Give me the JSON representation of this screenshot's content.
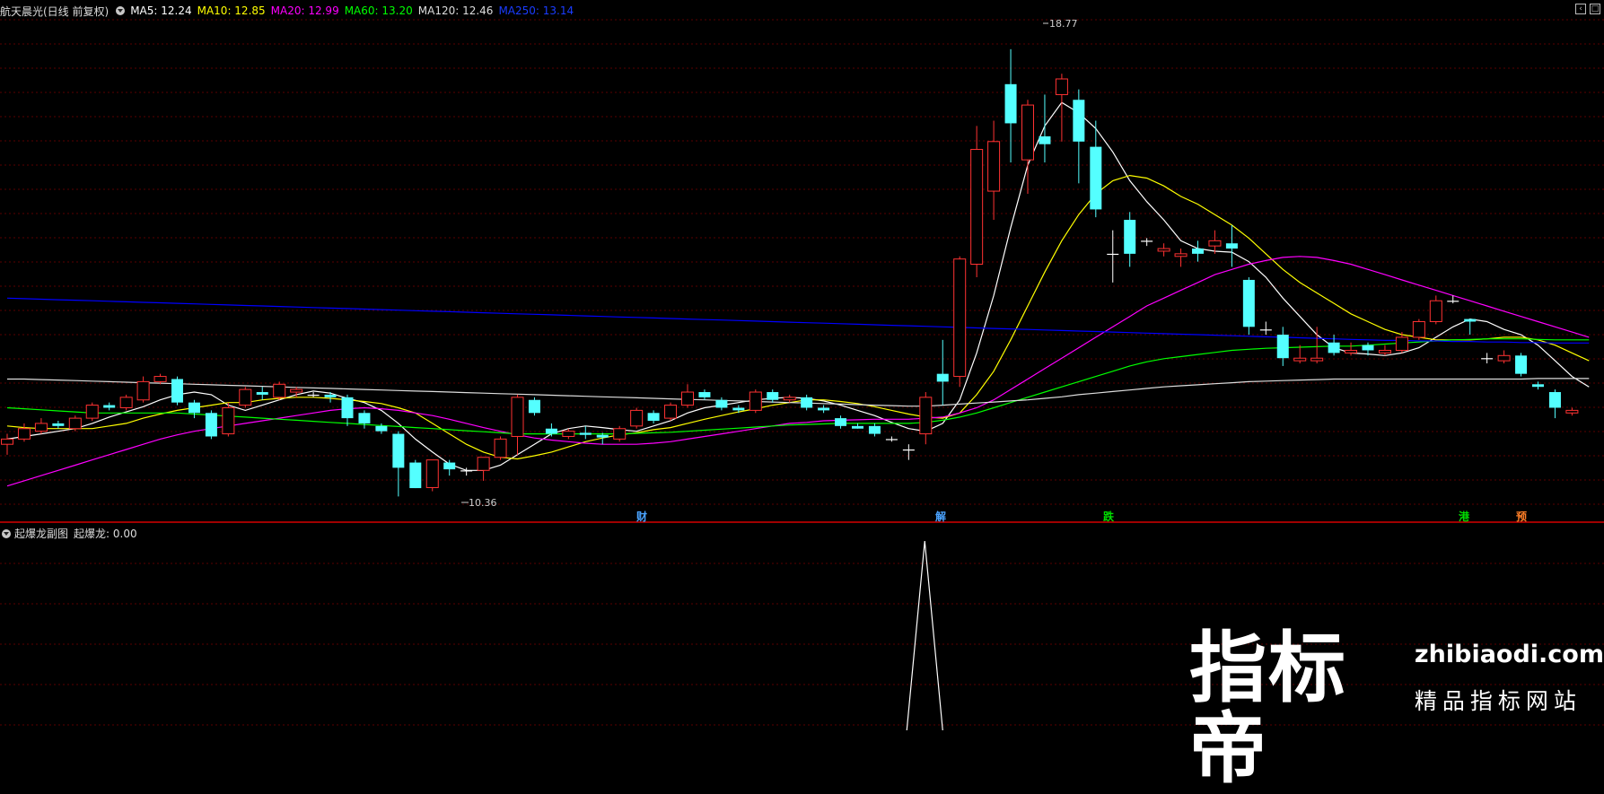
{
  "header": {
    "title": "航天晨光(日线 前复权)",
    "ma": [
      {
        "label": "MA5: 12.24",
        "color": "#ffffff"
      },
      {
        "label": "MA10: 12.85",
        "color": "#ffff00"
      },
      {
        "label": "MA20: 12.99",
        "color": "#ff00ff"
      },
      {
        "label": "MA60: 13.20",
        "color": "#00ff00"
      },
      {
        "label": "MA120: 12.46",
        "color": "#dddddd"
      },
      {
        "label": "MA250: 13.14",
        "color": "#0000ff"
      }
    ]
  },
  "annotations": {
    "high": "18.77",
    "low": "10.36"
  },
  "events": [
    {
      "label": "财",
      "color": "#4aa3ff"
    },
    {
      "label": "解",
      "color": "#4aa3ff"
    },
    {
      "label": "跌",
      "color": "#00dd00"
    },
    {
      "label": "港",
      "color": "#00dd00"
    },
    {
      "label": "预",
      "color": "#ff7f27"
    }
  ],
  "sub_header": {
    "name": "起爆龙副图",
    "indicator": "起爆龙: 0.00"
  },
  "watermark": {
    "big": "指标帝",
    "url": "zhibiaodi.com",
    "slogan": "精品指标网站"
  },
  "colors": {
    "up": "#ff3232",
    "down": "#54ffff",
    "grid": "#5a0000",
    "divider": "#a00000"
  },
  "chart_data": {
    "type": "candlestick",
    "price_range": [
      10.0,
      19.3
    ],
    "candles": [
      [
        11.2,
        11.3,
        11.0,
        11.4
      ],
      [
        11.3,
        11.5,
        11.25,
        11.6
      ],
      [
        11.45,
        11.6,
        11.4,
        11.7
      ],
      [
        11.6,
        11.55,
        11.5,
        11.65
      ],
      [
        11.5,
        11.7,
        11.45,
        11.75
      ],
      [
        11.7,
        11.95,
        11.65,
        12.0
      ],
      [
        11.95,
        11.9,
        11.85,
        12.0
      ],
      [
        11.9,
        12.1,
        11.85,
        12.15
      ],
      [
        12.05,
        12.4,
        12.0,
        12.5
      ],
      [
        12.4,
        12.5,
        12.35,
        12.55
      ],
      [
        12.45,
        12.0,
        11.95,
        12.5
      ],
      [
        12.0,
        11.8,
        11.7,
        12.05
      ],
      [
        11.8,
        11.35,
        11.3,
        11.85
      ],
      [
        11.4,
        11.9,
        11.35,
        12.0
      ],
      [
        11.95,
        12.25,
        11.9,
        12.3
      ],
      [
        12.2,
        12.15,
        12.05,
        12.3
      ],
      [
        12.1,
        12.35,
        12.05,
        12.4
      ],
      [
        12.2,
        12.25,
        12.1,
        12.3
      ],
      [
        12.15,
        12.15,
        12.1,
        12.2
      ],
      [
        12.15,
        12.1,
        12.0,
        12.2
      ],
      [
        12.1,
        11.7,
        11.55,
        12.15
      ],
      [
        11.8,
        11.6,
        11.5,
        11.85
      ],
      [
        11.55,
        11.45,
        11.4,
        11.6
      ],
      [
        11.4,
        10.75,
        10.2,
        11.45
      ],
      [
        10.85,
        10.36,
        10.36,
        10.9
      ],
      [
        10.37,
        10.9,
        10.3,
        10.9
      ],
      [
        10.85,
        10.72,
        10.6,
        10.9
      ],
      [
        10.7,
        10.7,
        10.6,
        10.75
      ],
      [
        10.7,
        10.95,
        10.5,
        10.95
      ],
      [
        10.95,
        11.3,
        10.9,
        11.35
      ],
      [
        11.35,
        12.1,
        11.0,
        12.15
      ],
      [
        12.05,
        11.8,
        11.75,
        12.1
      ],
      [
        11.5,
        11.4,
        11.35,
        11.6
      ],
      [
        11.35,
        11.45,
        11.3,
        11.5
      ],
      [
        11.42,
        11.38,
        11.3,
        11.55
      ],
      [
        11.38,
        11.33,
        11.2,
        11.42
      ],
      [
        11.3,
        11.5,
        11.25,
        11.55
      ],
      [
        11.55,
        11.85,
        11.5,
        11.9
      ],
      [
        11.8,
        11.65,
        11.6,
        11.85
      ],
      [
        11.7,
        11.95,
        11.65,
        12.0
      ],
      [
        11.95,
        12.2,
        11.9,
        12.35
      ],
      [
        12.2,
        12.1,
        12.05,
        12.25
      ],
      [
        12.05,
        11.9,
        11.85,
        12.1
      ],
      [
        11.9,
        11.85,
        11.8,
        11.95
      ],
      [
        11.85,
        12.2,
        11.8,
        12.25
      ],
      [
        12.2,
        12.05,
        12.0,
        12.25
      ],
      [
        12.05,
        12.1,
        12.0,
        12.15
      ],
      [
        12.1,
        11.9,
        11.85,
        12.15
      ],
      [
        11.9,
        11.85,
        11.8,
        11.95
      ],
      [
        11.7,
        11.55,
        11.5,
        11.75
      ],
      [
        11.55,
        11.5,
        11.5,
        11.6
      ],
      [
        11.55,
        11.4,
        11.35,
        11.6
      ],
      [
        11.3,
        11.3,
        11.25,
        11.35
      ],
      [
        11.1,
        11.1,
        10.9,
        11.2
      ],
      [
        11.4,
        12.1,
        11.2,
        12.2
      ],
      [
        12.55,
        12.4,
        11.95,
        13.2
      ],
      [
        12.5,
        14.75,
        12.3,
        14.8
      ],
      [
        14.65,
        16.85,
        14.4,
        17.3
      ],
      [
        16.05,
        17.0,
        15.5,
        17.4
      ],
      [
        18.1,
        17.35,
        16.6,
        18.77
      ],
      [
        16.65,
        17.7,
        16.0,
        17.8
      ],
      [
        17.1,
        16.95,
        16.6,
        17.9
      ],
      [
        17.9,
        18.2,
        17.0,
        18.3
      ],
      [
        17.8,
        17.0,
        16.2,
        18.0
      ],
      [
        16.9,
        15.7,
        15.55,
        17.4
      ],
      [
        14.85,
        14.85,
        14.3,
        15.3
      ],
      [
        15.5,
        14.85,
        14.6,
        15.65
      ],
      [
        15.1,
        15.1,
        15.0,
        15.15
      ],
      [
        14.9,
        14.95,
        14.8,
        15.05
      ],
      [
        14.8,
        14.85,
        14.6,
        14.95
      ],
      [
        14.95,
        14.85,
        14.7,
        15.1
      ],
      [
        15.0,
        15.1,
        14.85,
        15.3
      ],
      [
        15.05,
        14.95,
        14.6,
        15.4
      ],
      [
        14.35,
        13.45,
        13.3,
        14.4
      ],
      [
        13.4,
        13.4,
        13.3,
        13.55
      ],
      [
        13.3,
        12.85,
        12.7,
        13.45
      ],
      [
        12.8,
        12.85,
        12.75,
        13.1
      ],
      [
        12.8,
        12.85,
        12.75,
        13.45
      ],
      [
        13.15,
        12.95,
        12.9,
        13.3
      ],
      [
        12.95,
        13.0,
        12.9,
        13.15
      ],
      [
        13.1,
        13.0,
        12.9,
        13.15
      ],
      [
        12.95,
        13.0,
        12.9,
        13.1
      ],
      [
        13.0,
        13.25,
        12.95,
        13.35
      ],
      [
        13.25,
        13.55,
        13.2,
        13.6
      ],
      [
        13.55,
        13.95,
        13.5,
        14.05
      ],
      [
        13.95,
        13.95,
        13.9,
        14.05
      ],
      [
        13.6,
        13.55,
        13.3,
        13.6
      ],
      [
        12.85,
        12.85,
        12.75,
        12.95
      ],
      [
        12.8,
        12.9,
        12.75,
        13.0
      ],
      [
        12.9,
        12.55,
        12.5,
        12.95
      ],
      [
        12.35,
        12.3,
        12.25,
        12.4
      ],
      [
        12.2,
        11.9,
        11.7,
        12.25
      ],
      [
        11.8,
        11.85,
        11.75,
        11.9
      ]
    ],
    "ma_series": [
      {
        "label": "MA5",
        "values": [
          11.3,
          11.35,
          11.4,
          11.45,
          11.5,
          11.6,
          11.72,
          11.82,
          11.92,
          12.05,
          12.15,
          12.2,
          12.15,
          11.95,
          11.85,
          11.95,
          12.05,
          12.15,
          12.22,
          12.18,
          12.08,
          12.0,
          11.85,
          11.6,
          11.3,
          11.05,
          10.82,
          10.7,
          10.7,
          10.8,
          11.0,
          11.2,
          11.4,
          11.5,
          11.55,
          11.52,
          11.48,
          11.45,
          11.55,
          11.65,
          11.8,
          11.9,
          11.95,
          12.0,
          12.05,
          12.08,
          12.1,
          12.08,
          12.03,
          11.95,
          11.85,
          11.75,
          11.62,
          11.5,
          11.45,
          11.6,
          12.05,
          12.95,
          14.05,
          15.35,
          16.55,
          17.3,
          17.75,
          17.55,
          17.25,
          16.8,
          16.25,
          15.85,
          15.5,
          15.1,
          14.95,
          14.9,
          14.88,
          14.7,
          14.4,
          14.0,
          13.65,
          13.3,
          13.05,
          12.95,
          12.93,
          12.9,
          12.95,
          13.05,
          13.25,
          13.45,
          13.6,
          13.55,
          13.4,
          13.3,
          13.1,
          12.8,
          12.5,
          12.3
        ]
      },
      {
        "label": "MA10",
        "values": [
          11.55,
          11.52,
          11.5,
          11.5,
          11.5,
          11.5,
          11.55,
          11.6,
          11.7,
          11.78,
          11.85,
          11.9,
          11.95,
          12.0,
          12.0,
          12.05,
          12.08,
          12.1,
          12.1,
          12.08,
          12.05,
          12.02,
          11.98,
          11.9,
          11.8,
          11.6,
          11.4,
          11.2,
          11.05,
          10.95,
          10.92,
          10.98,
          11.05,
          11.15,
          11.25,
          11.32,
          11.38,
          11.42,
          11.48,
          11.52,
          11.6,
          11.68,
          11.75,
          11.82,
          11.88,
          11.95,
          12.0,
          12.05,
          12.05,
          12.02,
          11.98,
          11.92,
          11.85,
          11.78,
          11.72,
          11.7,
          11.8,
          12.15,
          12.6,
          13.2,
          13.85,
          14.5,
          15.1,
          15.6,
          16.0,
          16.25,
          16.35,
          16.3,
          16.15,
          15.95,
          15.8,
          15.6,
          15.4,
          15.15,
          14.85,
          14.55,
          14.3,
          14.1,
          13.9,
          13.7,
          13.55,
          13.4,
          13.3,
          13.25,
          13.2,
          13.2,
          13.2,
          13.22,
          13.25,
          13.25,
          13.2,
          13.1,
          12.95,
          12.8
        ]
      },
      {
        "label": "MA20",
        "values": [
          10.4,
          10.5,
          10.6,
          10.7,
          10.8,
          10.9,
          11.0,
          11.1,
          11.2,
          11.3,
          11.38,
          11.45,
          11.5,
          11.55,
          11.6,
          11.65,
          11.7,
          11.75,
          11.8,
          11.85,
          11.88,
          11.9,
          11.88,
          11.85,
          11.8,
          11.75,
          11.68,
          11.6,
          11.52,
          11.45,
          11.38,
          11.32,
          11.28,
          11.25,
          11.22,
          11.2,
          11.2,
          11.2,
          11.22,
          11.25,
          11.3,
          11.35,
          11.4,
          11.45,
          11.5,
          11.55,
          11.6,
          11.62,
          11.65,
          11.66,
          11.67,
          11.68,
          11.68,
          11.68,
          11.7,
          11.72,
          11.8,
          11.9,
          12.05,
          12.25,
          12.45,
          12.65,
          12.85,
          13.05,
          13.25,
          13.45,
          13.65,
          13.85,
          14.0,
          14.15,
          14.3,
          14.45,
          14.55,
          14.65,
          14.72,
          14.78,
          14.8,
          14.78,
          14.72,
          14.65,
          14.55,
          14.45,
          14.35,
          14.25,
          14.15,
          14.05,
          13.95,
          13.85,
          13.75,
          13.65,
          13.55,
          13.45,
          13.35,
          13.25
        ]
      },
      {
        "label": "MA60",
        "values": [
          11.9,
          11.88,
          11.86,
          11.84,
          11.82,
          11.8,
          11.8,
          11.8,
          11.8,
          11.8,
          11.8,
          11.78,
          11.76,
          11.74,
          11.72,
          11.7,
          11.68,
          11.66,
          11.64,
          11.62,
          11.6,
          11.58,
          11.56,
          11.54,
          11.52,
          11.5,
          11.48,
          11.46,
          11.44,
          11.42,
          11.4,
          11.4,
          11.4,
          11.4,
          11.4,
          11.4,
          11.4,
          11.41,
          11.42,
          11.43,
          11.45,
          11.47,
          11.49,
          11.51,
          11.53,
          11.55,
          11.57,
          11.58,
          11.59,
          11.6,
          11.6,
          11.6,
          11.6,
          11.6,
          11.62,
          11.66,
          11.72,
          11.8,
          11.9,
          12.0,
          12.1,
          12.2,
          12.3,
          12.4,
          12.5,
          12.6,
          12.7,
          12.78,
          12.84,
          12.88,
          12.92,
          12.96,
          13.0,
          13.02,
          13.04,
          13.05,
          13.06,
          13.07,
          13.08,
          13.08,
          13.1,
          13.12,
          13.14,
          13.16,
          13.18,
          13.2,
          13.21,
          13.22,
          13.22,
          13.22,
          13.21,
          13.2,
          13.2,
          13.2
        ]
      },
      {
        "label": "MA120",
        "values": [
          12.45,
          12.45,
          12.44,
          12.43,
          12.42,
          12.41,
          12.4,
          12.39,
          12.38,
          12.37,
          12.36,
          12.35,
          12.34,
          12.33,
          12.32,
          12.31,
          12.3,
          12.29,
          12.28,
          12.27,
          12.26,
          12.25,
          12.24,
          12.23,
          12.22,
          12.21,
          12.2,
          12.19,
          12.18,
          12.17,
          12.16,
          12.15,
          12.14,
          12.13,
          12.12,
          12.11,
          12.1,
          12.09,
          12.08,
          12.07,
          12.06,
          12.05,
          12.04,
          12.03,
          12.02,
          12.01,
          12.0,
          11.99,
          11.98,
          11.97,
          11.96,
          11.95,
          11.94,
          11.93,
          11.93,
          11.95,
          11.97,
          11.99,
          12.01,
          12.03,
          12.05,
          12.08,
          12.11,
          12.15,
          12.18,
          12.21,
          12.24,
          12.27,
          12.3,
          12.32,
          12.34,
          12.36,
          12.38,
          12.4,
          12.41,
          12.42,
          12.43,
          12.44,
          12.45,
          12.45,
          12.45,
          12.45,
          12.45,
          12.45,
          12.45,
          12.45,
          12.45,
          12.45,
          12.45,
          12.45,
          12.46,
          12.46,
          12.46,
          12.46
        ]
      },
      {
        "label": "MA250",
        "values": [
          14.0,
          13.99,
          13.98,
          13.97,
          13.96,
          13.95,
          13.94,
          13.93,
          13.92,
          13.91,
          13.9,
          13.89,
          13.88,
          13.87,
          13.86,
          13.85,
          13.84,
          13.83,
          13.82,
          13.81,
          13.8,
          13.79,
          13.78,
          13.77,
          13.76,
          13.75,
          13.74,
          13.73,
          13.72,
          13.71,
          13.7,
          13.69,
          13.68,
          13.67,
          13.66,
          13.65,
          13.64,
          13.63,
          13.62,
          13.61,
          13.6,
          13.59,
          13.58,
          13.57,
          13.56,
          13.55,
          13.54,
          13.53,
          13.52,
          13.51,
          13.5,
          13.49,
          13.48,
          13.47,
          13.46,
          13.45,
          13.44,
          13.43,
          13.42,
          13.41,
          13.4,
          13.39,
          13.38,
          13.37,
          13.36,
          13.35,
          13.34,
          13.33,
          13.32,
          13.31,
          13.3,
          13.29,
          13.28,
          13.27,
          13.26,
          13.25,
          13.24,
          13.23,
          13.22,
          13.21,
          13.2,
          13.19,
          13.19,
          13.18,
          13.18,
          13.17,
          13.17,
          13.16,
          13.16,
          13.15,
          13.15,
          13.14,
          13.14,
          13.14
        ]
      }
    ],
    "sub_indicator": {
      "label": "起爆龙",
      "signal_index": 55,
      "signal_value": 1
    }
  }
}
